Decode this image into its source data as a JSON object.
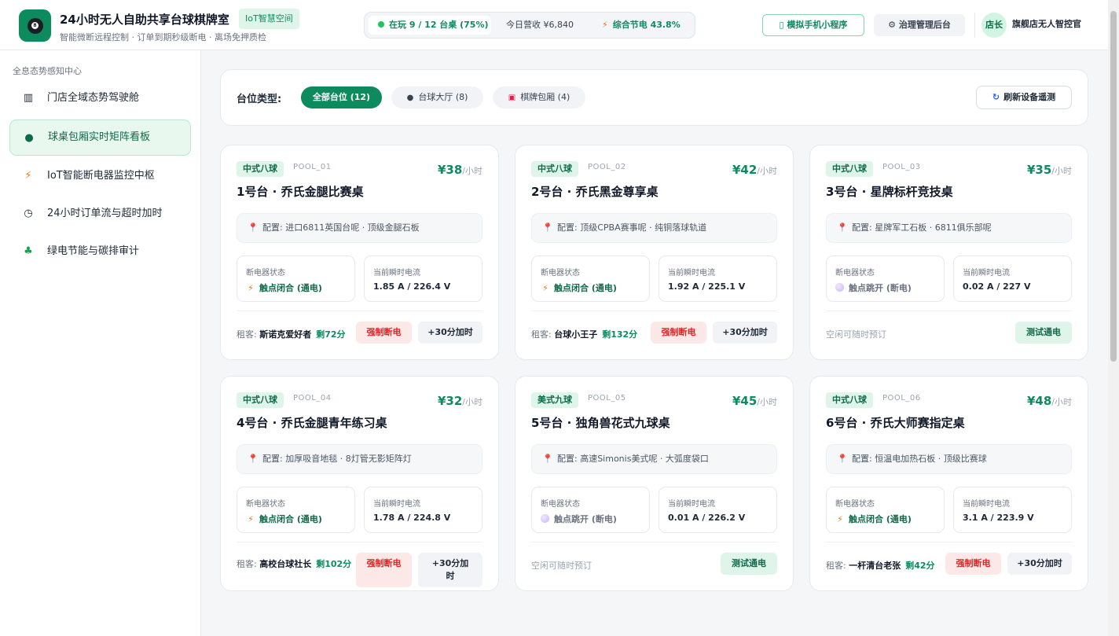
{
  "header": {
    "title": "24小时无人自助共享台球棋牌室",
    "badge": "IoT智慧空间",
    "subtitle": "智能微断远程控制 · 订单到期秒级断电 · 离场免押质检",
    "stats": {
      "live": "在玩 9 / 12 台桌 (75%)",
      "revenue": "今日营收 ¥6,840",
      "saving": "综合节电 43.8%"
    },
    "mini_program_btn": "模拟手机小程序",
    "admin_btn": "治理管理后台",
    "avatar": "店长",
    "user": "旗舰店无人智控官"
  },
  "sidebar": {
    "heading": "全息态势感知中心",
    "items": [
      {
        "label": "门店全域态势驾驶舱",
        "icon": "chart-icon"
      },
      {
        "label": "球桌包厢实时矩阵看板",
        "icon": "billiard-ball-icon",
        "active": true
      },
      {
        "label": "IoT智能断电器监控中枢",
        "icon": "bolt-icon"
      },
      {
        "label": "24小时订单流与超时加时",
        "icon": "stopwatch-icon"
      },
      {
        "label": "绿电节能与碳排审计",
        "icon": "sprout-icon"
      }
    ]
  },
  "filter": {
    "label": "台位类型:",
    "chips": [
      "全部台位 (12)",
      "台球大厅 (8)",
      "棋牌包厢 (4)"
    ],
    "refresh": "刷新设备遥测"
  },
  "common": {
    "breaker_label": "断电器状态",
    "current_label": "当前瞬时电流",
    "on_text": "触点闭合 (通电)",
    "off_text": "触点跳开 (断电)",
    "tenant_prefix": "租客: ",
    "cut_btn": "强制断电",
    "add_btn": "+30分加时",
    "idle_text": "空闲可随时预订",
    "test_btn": "测试通电",
    "unit": "/小时"
  },
  "tables": [
    {
      "tag": "中式八球",
      "code": "POOL_01",
      "price": "¥38",
      "name": "1号台 · 乔氏金腿比赛桌",
      "config": "配置: 进口6811英国台呢 · 顶级金腿石板",
      "power": "on",
      "current": "1.85 A / 226.4 V",
      "tenant": "斯诺克爱好者",
      "remaining": "剩72分"
    },
    {
      "tag": "中式八球",
      "code": "POOL_02",
      "price": "¥42",
      "name": "2号台 · 乔氏黑金尊享桌",
      "config": "配置: 顶级CPBA赛事呢 · 纯铜落球轨道",
      "power": "on",
      "current": "1.92 A / 225.1 V",
      "tenant": "台球小王子",
      "remaining": "剩132分"
    },
    {
      "tag": "中式八球",
      "code": "POOL_03",
      "price": "¥35",
      "name": "3号台 · 星牌标杆竞技桌",
      "config": "配置: 星牌军工石板 · 6811俱乐部呢",
      "power": "off",
      "current": "0.02 A / 227 V"
    },
    {
      "tag": "中式八球",
      "code": "POOL_04",
      "price": "¥32",
      "name": "4号台 · 乔氏金腿青年练习桌",
      "config": "配置: 加厚吸音地毯 · 8灯管无影矩阵灯",
      "power": "on",
      "current": "1.78 A / 224.8 V",
      "tenant": "高校台球社长",
      "remaining": "剩102分"
    },
    {
      "tag": "美式九球",
      "code": "POOL_05",
      "price": "¥45",
      "name": "5号台 · 独角兽花式九球桌",
      "config": "配置: 高速Simonis美式呢 · 大弧度袋口",
      "power": "off",
      "current": "0.01 A / 226.2 V"
    },
    {
      "tag": "中式八球",
      "code": "POOL_06",
      "price": "¥48",
      "name": "6号台 · 乔氏大师赛指定桌",
      "config": "配置: 恒温电加热石板 · 顶级比赛球",
      "power": "on",
      "current": "3.1 A / 223.9 V",
      "tenant": "一杆清台老张",
      "remaining": "剩42分"
    }
  ]
}
